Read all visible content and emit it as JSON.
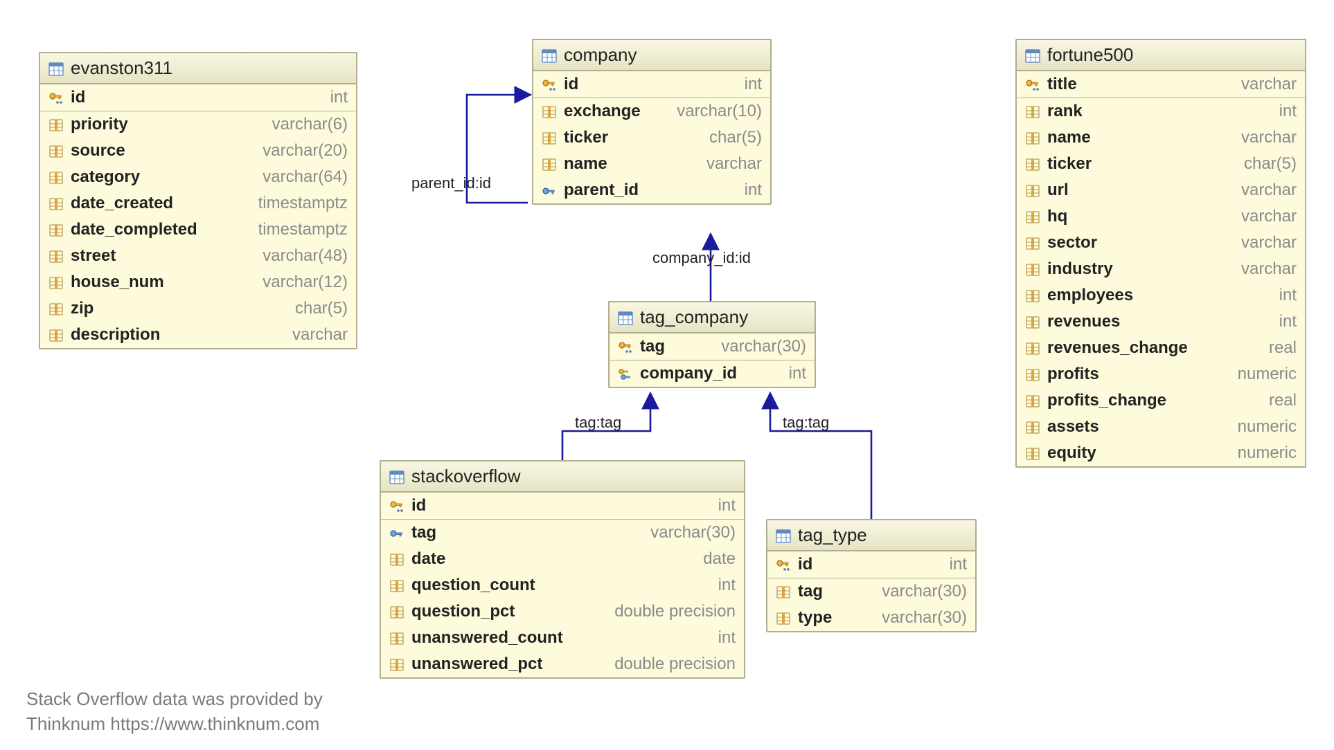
{
  "footer": {
    "line1": "Stack Overflow data was provided by",
    "line2": "Thinknum https://www.thinknum.com"
  },
  "relations": {
    "parent_id": "parent_id:id",
    "company_id": "company_id:id",
    "tag_tag_left": "tag:tag",
    "tag_tag_right": "tag:tag"
  },
  "tables": {
    "evanston311": {
      "title": "evanston311",
      "rows": [
        {
          "name": "id",
          "type": "int",
          "icon": "pk"
        },
        {
          "name": "priority",
          "type": "varchar(6)",
          "icon": "col"
        },
        {
          "name": "source",
          "type": "varchar(20)",
          "icon": "col"
        },
        {
          "name": "category",
          "type": "varchar(64)",
          "icon": "col"
        },
        {
          "name": "date_created",
          "type": "timestamptz",
          "icon": "col"
        },
        {
          "name": "date_completed",
          "type": "timestamptz",
          "icon": "col"
        },
        {
          "name": "street",
          "type": "varchar(48)",
          "icon": "col"
        },
        {
          "name": "house_num",
          "type": "varchar(12)",
          "icon": "col"
        },
        {
          "name": "zip",
          "type": "char(5)",
          "icon": "col"
        },
        {
          "name": "description",
          "type": "varchar",
          "icon": "col"
        }
      ]
    },
    "company": {
      "title": "company",
      "rows": [
        {
          "name": "id",
          "type": "int",
          "icon": "pk"
        },
        {
          "name": "exchange",
          "type": "varchar(10)",
          "icon": "col"
        },
        {
          "name": "ticker",
          "type": "char(5)",
          "icon": "col"
        },
        {
          "name": "name",
          "type": "varchar",
          "icon": "col"
        },
        {
          "name": "parent_id",
          "type": "int",
          "icon": "fk"
        }
      ]
    },
    "tag_company": {
      "title": "tag_company",
      "rows": [
        {
          "name": "tag",
          "type": "varchar(30)",
          "icon": "pk"
        },
        {
          "name": "company_id",
          "type": "int",
          "icon": "pkfk"
        }
      ]
    },
    "stackoverflow": {
      "title": "stackoverflow",
      "rows": [
        {
          "name": "id",
          "type": "int",
          "icon": "pk"
        },
        {
          "name": "tag",
          "type": "varchar(30)",
          "icon": "fk"
        },
        {
          "name": "date",
          "type": "date",
          "icon": "col"
        },
        {
          "name": "question_count",
          "type": "int",
          "icon": "col"
        },
        {
          "name": "question_pct",
          "type": "double precision",
          "icon": "col"
        },
        {
          "name": "unanswered_count",
          "type": "int",
          "icon": "col"
        },
        {
          "name": "unanswered_pct",
          "type": "double precision",
          "icon": "col"
        }
      ]
    },
    "tag_type": {
      "title": "tag_type",
      "rows": [
        {
          "name": "id",
          "type": "int",
          "icon": "pk"
        },
        {
          "name": "tag",
          "type": "varchar(30)",
          "icon": "col"
        },
        {
          "name": "type",
          "type": "varchar(30)",
          "icon": "col"
        }
      ]
    },
    "fortune500": {
      "title": "fortune500",
      "rows": [
        {
          "name": "title",
          "type": "varchar",
          "icon": "pk"
        },
        {
          "name": "rank",
          "type": "int",
          "icon": "col"
        },
        {
          "name": "name",
          "type": "varchar",
          "icon": "col"
        },
        {
          "name": "ticker",
          "type": "char(5)",
          "icon": "col"
        },
        {
          "name": "url",
          "type": "varchar",
          "icon": "col"
        },
        {
          "name": "hq",
          "type": "varchar",
          "icon": "col"
        },
        {
          "name": "sector",
          "type": "varchar",
          "icon": "col"
        },
        {
          "name": "industry",
          "type": "varchar",
          "icon": "col"
        },
        {
          "name": "employees",
          "type": "int",
          "icon": "col"
        },
        {
          "name": "revenues",
          "type": "int",
          "icon": "col"
        },
        {
          "name": "revenues_change",
          "type": "real",
          "icon": "col"
        },
        {
          "name": "profits",
          "type": "numeric",
          "icon": "col"
        },
        {
          "name": "profits_change",
          "type": "real",
          "icon": "col"
        },
        {
          "name": "assets",
          "type": "numeric",
          "icon": "col"
        },
        {
          "name": "equity",
          "type": "numeric",
          "icon": "col"
        }
      ]
    }
  }
}
